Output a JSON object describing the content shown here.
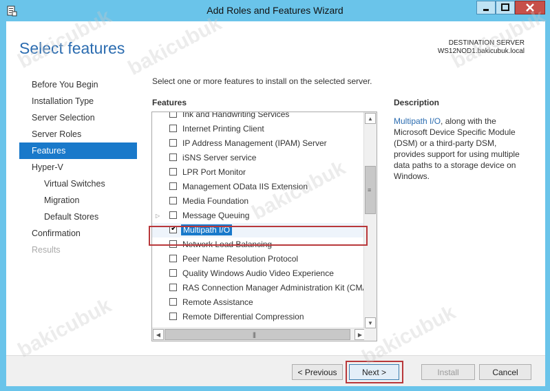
{
  "window": {
    "title": "Add Roles and Features Wizard"
  },
  "header": {
    "page_title": "Select features",
    "dest_label": "DESTINATION SERVER",
    "dest_value": "WS12NOD1.bakicubuk.local"
  },
  "nav": {
    "items": [
      {
        "label": "Before You Begin",
        "state": "normal"
      },
      {
        "label": "Installation Type",
        "state": "normal"
      },
      {
        "label": "Server Selection",
        "state": "normal"
      },
      {
        "label": "Server Roles",
        "state": "normal"
      },
      {
        "label": "Features",
        "state": "active"
      },
      {
        "label": "Hyper-V",
        "state": "normal"
      },
      {
        "label": "Virtual Switches",
        "state": "sub"
      },
      {
        "label": "Migration",
        "state": "sub"
      },
      {
        "label": "Default Stores",
        "state": "sub"
      },
      {
        "label": "Confirmation",
        "state": "normal"
      },
      {
        "label": "Results",
        "state": "disabled"
      }
    ]
  },
  "main": {
    "intro": "Select one or more features to install on the selected server.",
    "features_label": "Features",
    "features": [
      {
        "label": "Ink and Handwriting Services",
        "checked": false
      },
      {
        "label": "Internet Printing Client",
        "checked": false
      },
      {
        "label": "IP Address Management (IPAM) Server",
        "checked": false
      },
      {
        "label": "iSNS Server service",
        "checked": false
      },
      {
        "label": "LPR Port Monitor",
        "checked": false
      },
      {
        "label": "Management OData IIS Extension",
        "checked": false
      },
      {
        "label": "Media Foundation",
        "checked": false
      },
      {
        "label": "Message Queuing",
        "checked": false,
        "expandable": true
      },
      {
        "label": "Multipath I/O",
        "checked": true,
        "selected": true
      },
      {
        "label": "Network Load Balancing",
        "checked": false
      },
      {
        "label": "Peer Name Resolution Protocol",
        "checked": false
      },
      {
        "label": "Quality Windows Audio Video Experience",
        "checked": false
      },
      {
        "label": "RAS Connection Manager Administration Kit (CMA",
        "checked": false
      },
      {
        "label": "Remote Assistance",
        "checked": false
      },
      {
        "label": "Remote Differential Compression",
        "checked": false
      }
    ]
  },
  "description": {
    "title": "Description",
    "link": "Multipath I/O",
    "text": ", along with the Microsoft Device Specific Module (DSM) or a third-party DSM, provides support for using multiple data paths to a storage device on Windows."
  },
  "footer": {
    "previous": "< Previous",
    "next": "Next >",
    "install": "Install",
    "cancel": "Cancel"
  },
  "watermark": "bakicubuk",
  "colors": {
    "accent": "#1979ca",
    "titlebar": "#6ac4ea",
    "highlight": "#b8373a"
  }
}
